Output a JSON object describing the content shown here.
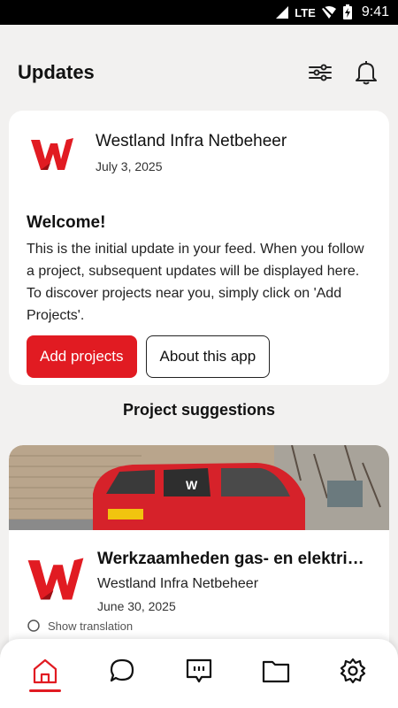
{
  "status_bar": {
    "network": "LTE",
    "time": "9:41"
  },
  "header": {
    "title": "Updates",
    "filter_icon": "sliders-icon",
    "bell_icon": "bell-icon"
  },
  "welcome_card": {
    "org_name": "Westland Infra Netbeheer",
    "date": "July 3, 2025",
    "title": "Welcome!",
    "body": "This is the initial update in your feed. When you follow a project, subsequent updates will be displayed here. To discover projects near you, simply click on 'Add Projects'.",
    "primary_button": "Add projects",
    "secondary_button": "About this app"
  },
  "suggestions": {
    "heading": "Project suggestions",
    "items": [
      {
        "title": "Werkzaamheden gas- en elektriciteit...",
        "org": "Westland Infra Netbeheer",
        "date": "June 30, 2025",
        "extra": "Show translation"
      }
    ]
  },
  "bottom_nav": {
    "items": [
      {
        "icon": "home-icon",
        "active": true
      },
      {
        "icon": "chat-icon",
        "active": false
      },
      {
        "icon": "message-icon",
        "active": false
      },
      {
        "icon": "folder-icon",
        "active": false
      },
      {
        "icon": "settings-icon",
        "active": false
      }
    ]
  },
  "colors": {
    "brand": "#e11b22",
    "background": "#f2f1f0",
    "card": "#ffffff"
  }
}
